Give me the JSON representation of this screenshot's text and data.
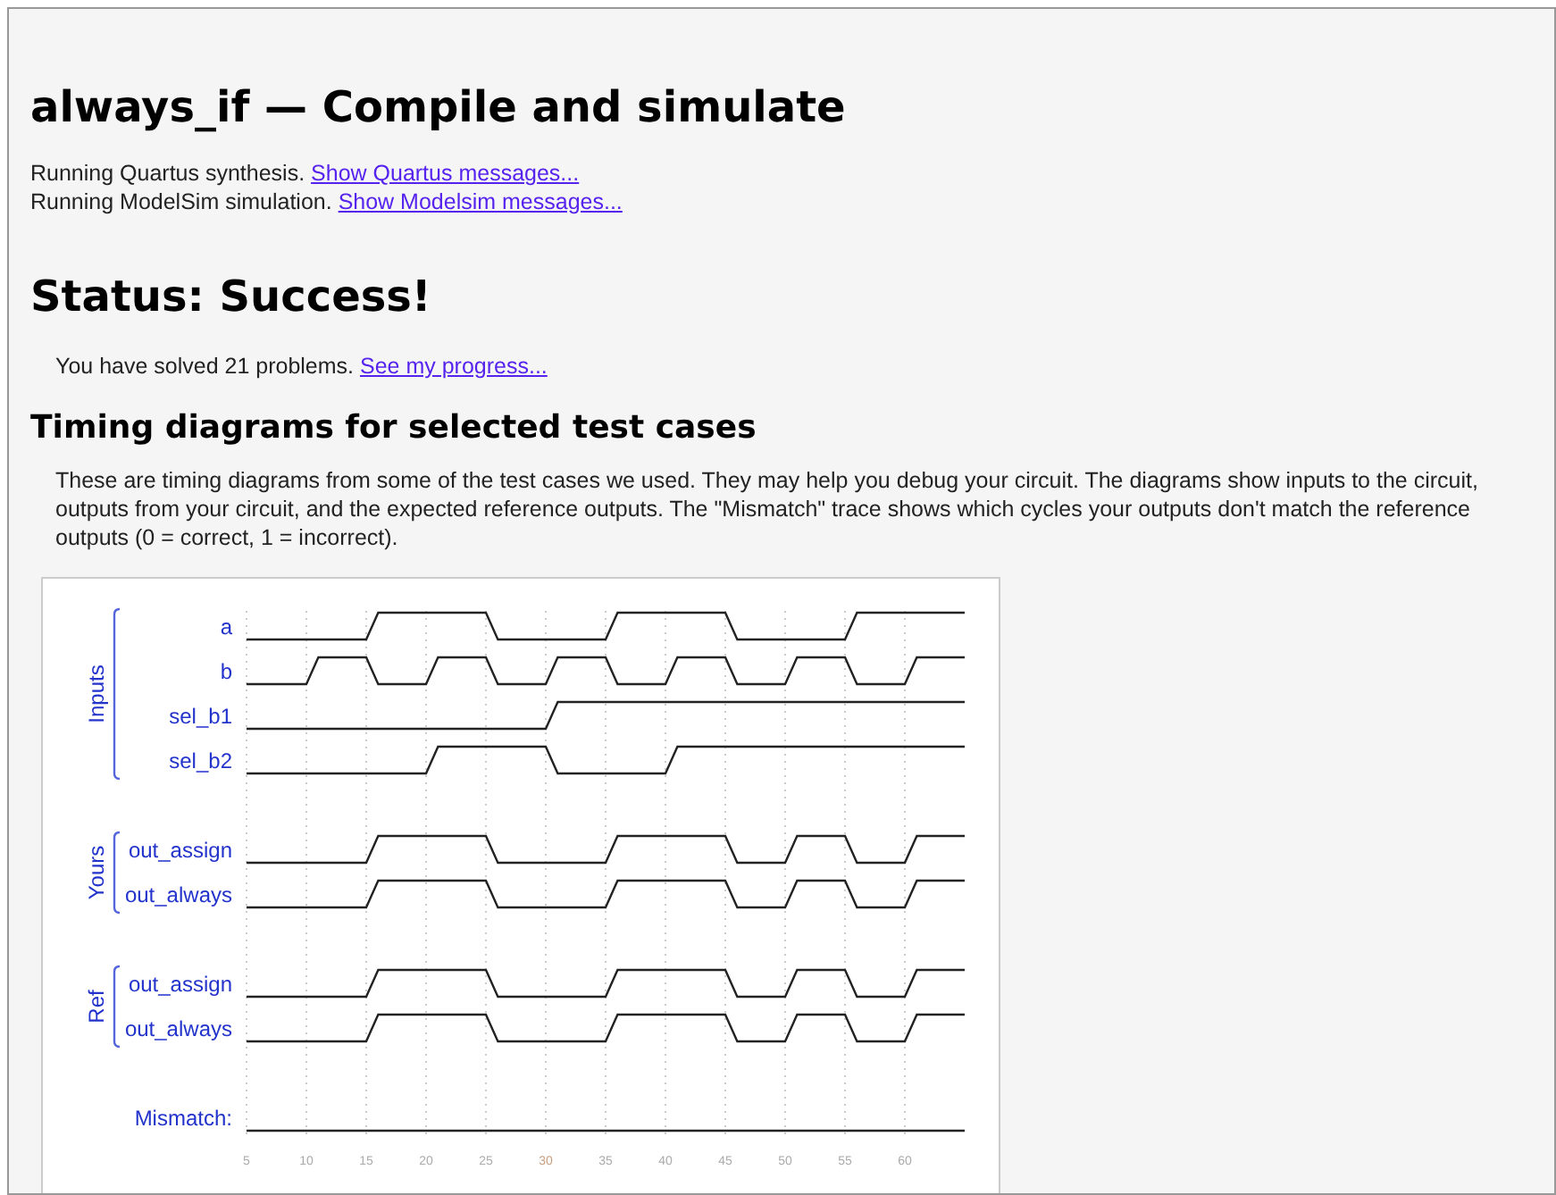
{
  "title": "always_if — Compile and simulate",
  "messages": [
    {
      "text": "Running Quartus synthesis.",
      "link": "Show Quartus messages..."
    },
    {
      "text": "Running ModelSim simulation.",
      "link": "Show Modelsim messages..."
    }
  ],
  "status": "Status: Success!",
  "progress": {
    "text": "You have solved 21 problems.",
    "link": "See my progress..."
  },
  "timing_heading": "Timing diagrams for selected test cases",
  "timing_text": "These are timing diagrams from some of the test cases we used. They may help you debug your circuit. The diagrams show inputs to the circuit, outputs from your circuit, and the expected reference outputs. The \"Mismatch\" trace shows which cycles your outputs don't match the reference outputs (0 = correct, 1 = incorrect).",
  "timing_diagram": {
    "groups": [
      {
        "label": "Inputs",
        "signals": [
          {
            "name": "a"
          },
          {
            "name": "b"
          },
          {
            "name": "sel_b1"
          },
          {
            "name": "sel_b2"
          }
        ]
      },
      {
        "label": "Yours",
        "signals": [
          {
            "name": "out_assign"
          },
          {
            "name": "out_always"
          }
        ]
      },
      {
        "label": "Ref",
        "signals": [
          {
            "name": "out_assign"
          },
          {
            "name": "out_always"
          }
        ]
      }
    ],
    "mismatch_label": "Mismatch:",
    "ticks": [
      "5",
      "10",
      "15",
      "20",
      "25",
      "30",
      "35",
      "40",
      "45",
      "50",
      "55",
      "60"
    ]
  }
}
